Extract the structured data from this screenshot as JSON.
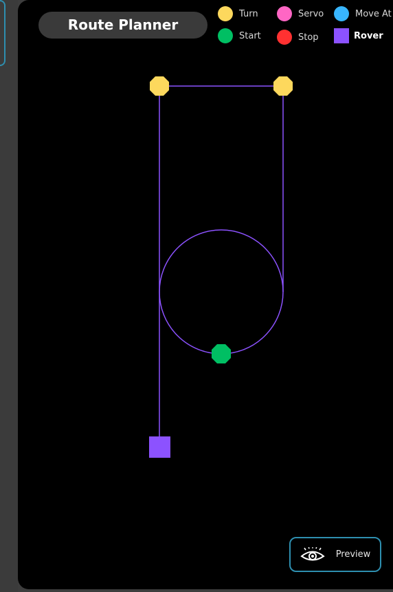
{
  "header": {
    "title": "Route Planner"
  },
  "legend": {
    "items": [
      {
        "label": "Turn",
        "color": "#fdd85d",
        "shape": "circle"
      },
      {
        "label": "Servo",
        "color": "#ff66c4",
        "shape": "circle"
      },
      {
        "label": "Move At",
        "color": "#38b6ff",
        "shape": "circle"
      },
      {
        "label": "Start",
        "color": "#00bf63",
        "shape": "circle"
      },
      {
        "label": "Stop",
        "color": "#ff3131",
        "shape": "circle"
      },
      {
        "label": "Rover",
        "color": "#8c52ff",
        "shape": "square"
      }
    ]
  },
  "route": {
    "path_color": "#8c52ff",
    "markers": [
      "turn",
      "turn",
      "start",
      "rover"
    ]
  },
  "preview": {
    "label": "Preview",
    "icon": "eye-icon"
  }
}
